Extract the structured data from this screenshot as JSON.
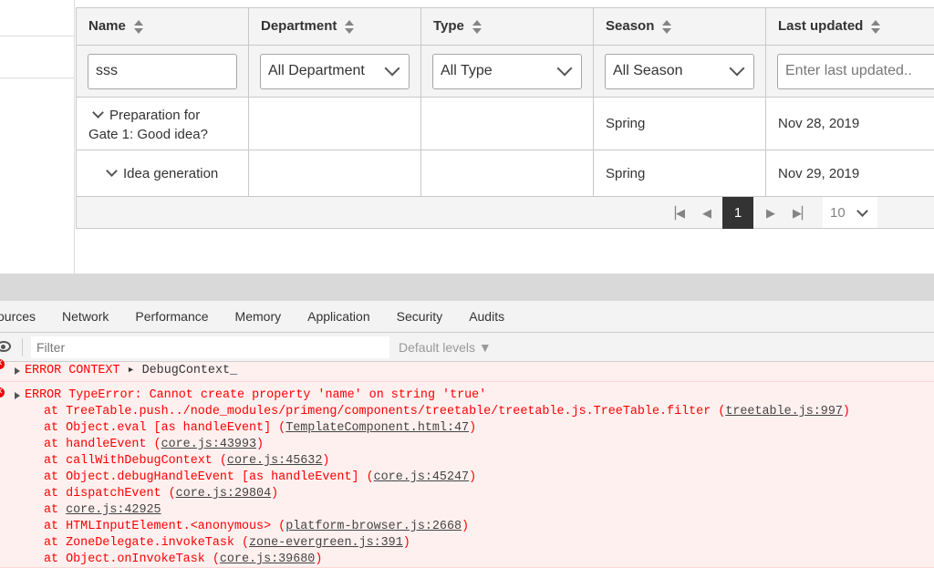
{
  "table": {
    "columns": [
      {
        "label": "Name"
      },
      {
        "label": "Department"
      },
      {
        "label": "Type"
      },
      {
        "label": "Season"
      },
      {
        "label": "Last updated"
      }
    ],
    "filters": {
      "name_value": "sss",
      "department_value": "All Department",
      "type_value": "All Type",
      "season_value": "All Season",
      "last_updated_placeholder": "Enter last updated.."
    },
    "rows": [
      {
        "name_line1": "Preparation for",
        "name_line2": "Gate 1: Good idea?",
        "department": "",
        "type": "",
        "season": "Spring",
        "last_updated": "Nov 28, 2019"
      },
      {
        "name": "Idea generation",
        "department": "",
        "type": "",
        "season": "Spring",
        "last_updated": "Nov 29, 2019"
      }
    ],
    "paginator": {
      "current_page": "1",
      "rows_per_page": "10"
    }
  },
  "devtools": {
    "tabs": [
      "ources",
      "Network",
      "Performance",
      "Memory",
      "Application",
      "Security",
      "Audits"
    ],
    "filter_placeholder": "Filter",
    "levels_label": "Default levels ▼",
    "messages": {
      "context_prefix": "ERROR CONTEXT ",
      "context_value": "DebugContext_",
      "error_line": "ERROR TypeError: Cannot create property 'name' on string 'true'",
      "trace": [
        {
          "text": "at TreeTable.push../node_modules/primeng/components/treetable/treetable.js.TreeTable.filter (",
          "link": "treetable.js:997",
          "end": ")"
        },
        {
          "text": "at Object.eval [as handleEvent] (",
          "link": "TemplateComponent.html:47",
          "end": ")"
        },
        {
          "text": "at handleEvent (",
          "link": "core.js:43993",
          "end": ")"
        },
        {
          "text": "at callWithDebugContext (",
          "link": "core.js:45632",
          "end": ")"
        },
        {
          "text": "at Object.debugHandleEvent [as handleEvent] (",
          "link": "core.js:45247",
          "end": ")"
        },
        {
          "text": "at dispatchEvent (",
          "link": "core.js:29804",
          "end": ")"
        },
        {
          "text": "at ",
          "link": "core.js:42925",
          "end": ""
        },
        {
          "text": "at HTMLInputElement.<anonymous> (",
          "link": "platform-browser.js:2668",
          "end": ")"
        },
        {
          "text": "at ZoneDelegate.invokeTask (",
          "link": "zone-evergreen.js:391",
          "end": ")"
        },
        {
          "text": "at Object.onInvokeTask (",
          "link": "core.js:39680",
          "end": ")"
        }
      ]
    }
  }
}
